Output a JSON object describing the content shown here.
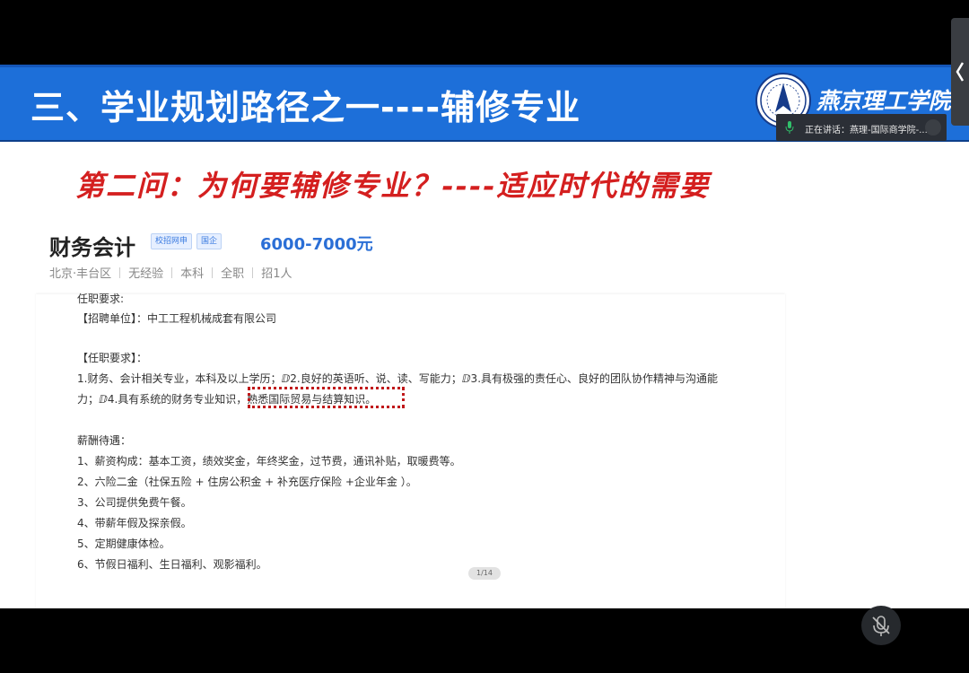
{
  "banner": {
    "title": "三、学业规划路径之一----辅修专业",
    "school_name": "燕京理工学院"
  },
  "speaking": {
    "text": "正在讲话：燕理-国际商学院-..."
  },
  "slide": {
    "subtitle": "第二问：为何要辅修专业？----适应时代的需要"
  },
  "job": {
    "title": "财务会计",
    "tags": [
      "校招网申",
      "国企"
    ],
    "salary": "6000-7000元",
    "meta": [
      "北京·丰台区",
      "无经验",
      "本科",
      "全职",
      "招1人"
    ]
  },
  "description": {
    "lines": [
      "任职要求:",
      "【招聘单位】：中工工程机械成套有限公司",
      "【任职要求】：",
      "1.财务、会计相关专业，本科及以上学历；ⅅ2.良好的英语听、说、读、写能力；ⅅ3.具有极强的责任心、良好的团队协作精神与沟通能",
      "力；ⅅ4.具有系统的财务专业知识，熟悉国际贸易与结算知识。",
      "薪酬待遇：",
      "1、薪资构成：基本工资，绩效奖金，年终奖金，过节费，通讯补贴，取暖费等。",
      "2、六险二金（社保五险 + 住房公积金 + 补充医疗保险 +企业年金 ）。",
      "3、公司提供免费午餐。",
      "4、带薪年假及探亲假。",
      "5、定期健康体检。",
      "6、节假日福利、生日福利、观影福利。"
    ],
    "highlight": "熟悉国际贸易与结算知识。"
  },
  "page_indicator": "1/14",
  "colors": {
    "banner_blue": "#1d6fd9",
    "subtitle_red": "#d41f1f",
    "salary_blue": "#2b6fd6"
  },
  "toolbar": {
    "icons": [
      "prev-icon",
      "next-icon",
      "pen-icon",
      "screenshot-icon",
      "camera-icon",
      "more-icon",
      "collapse-icon"
    ]
  }
}
